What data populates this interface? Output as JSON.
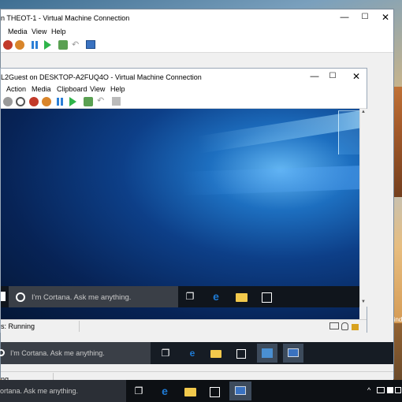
{
  "outer_window": {
    "title": "n THEOT-1 - Virtual Machine Connection",
    "controls": {
      "minimize": "—",
      "maximize": "☐",
      "close": "✕"
    },
    "menu": [
      "Media",
      "View",
      "Help"
    ],
    "status": "ng"
  },
  "inner_window": {
    "title": "L2Guest on DESKTOP-A2FUQ4O - Virtual Machine Connection",
    "controls": {
      "minimize": "—",
      "maximize": "☐",
      "close": "✕"
    },
    "menu": [
      "Action",
      "Media",
      "Clipboard",
      "View",
      "Help"
    ],
    "status": "s: Running"
  },
  "inner_taskbar": {
    "search_placeholder": "I'm Cortana. Ask me anything."
  },
  "outer_taskbar": {
    "search_placeholder": "I'm Cortana. Ask me anything."
  },
  "host_taskbar": {
    "search_placeholder": "ortana. Ask me anything."
  },
  "desktop": {
    "watermark": "Wind"
  },
  "colors": {
    "pause": "#2b7fd6",
    "start": "#2fb44a",
    "turn_off": "#c23a2a",
    "shutdown": "#d9852a",
    "edge_blue": "#1e7bd6",
    "folder_yellow": "#f2c94c"
  }
}
